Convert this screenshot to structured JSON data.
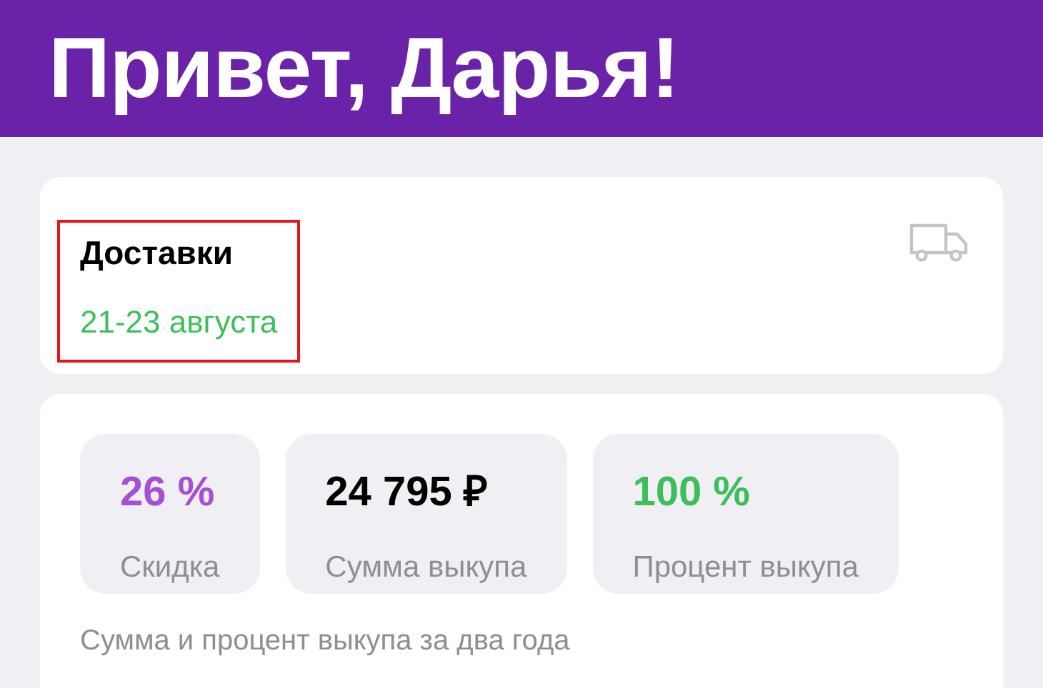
{
  "header": {
    "title": "Привет, Дарья!"
  },
  "delivery": {
    "title": "Доставки",
    "dates": "21-23 августа",
    "highlighted": true
  },
  "stats": [
    {
      "value": "26 %",
      "label": "Скидка",
      "color": "#a64fd6"
    },
    {
      "value": "24 795 ₽",
      "label": "Сумма выкупа",
      "color": "#000000"
    },
    {
      "value": "100 %",
      "label": "Процент выкупа",
      "color": "#3cbf5a"
    }
  ],
  "stats_note": "Сумма и процент выкупа за два года"
}
